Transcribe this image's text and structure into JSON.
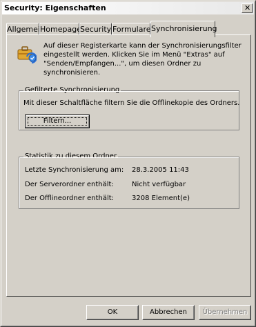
{
  "window": {
    "title": "Security: Eigenschaften",
    "close_glyph": "✕"
  },
  "tabs": [
    {
      "label": "Allgemein"
    },
    {
      "label": "Homepage"
    },
    {
      "label": "Security"
    },
    {
      "label": "Formulare"
    },
    {
      "label": "Synchronisierung",
      "active": true
    }
  ],
  "info": {
    "icon": "sync-briefcase-icon",
    "text": "Auf dieser Registerkarte kann der Synchronisierungsfilter eingestellt werden. Klicken Sie im Menü \"Extras\" auf \"Senden/Empfangen...\", um diesen Ordner zu synchronisieren."
  },
  "filter_group": {
    "title": "Gefilterte Synchronisierung",
    "description": "Mit dieser Schaltfläche filtern Sie die Offlinekopie des Ordners.",
    "button_label": "Filtern..."
  },
  "stats_group": {
    "title": "Statistik zu diesem Ordner",
    "rows": [
      {
        "label": "Letzte Synchronisierung am:",
        "value": "28.3.2005 11:43"
      },
      {
        "label": "Der Serverordner enthält:",
        "value": "Nicht verfügbar"
      },
      {
        "label": "Der Offlineordner enthält:",
        "value": "3208 Element(e)"
      }
    ]
  },
  "buttons": {
    "ok": "OK",
    "cancel": "Abbrechen",
    "apply": "Übernehmen"
  }
}
